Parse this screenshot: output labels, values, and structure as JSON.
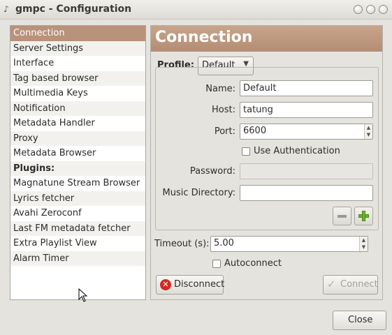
{
  "window": {
    "title": "gmpc - Configuration"
  },
  "sidebar": {
    "items": [
      {
        "label": "Connection"
      },
      {
        "label": "Server Settings"
      },
      {
        "label": "Interface"
      },
      {
        "label": "Tag based browser"
      },
      {
        "label": "Multimedia Keys"
      },
      {
        "label": "Notification"
      },
      {
        "label": "Metadata Handler"
      },
      {
        "label": "Proxy"
      },
      {
        "label": "Metadata Browser"
      },
      {
        "label": "Plugins:"
      },
      {
        "label": "Magnatune Stream Browser"
      },
      {
        "label": "Lyrics fetcher"
      },
      {
        "label": "Avahi Zeroconf"
      },
      {
        "label": "Last FM metadata fetcher"
      },
      {
        "label": "Extra Playlist View"
      },
      {
        "label": "Alarm Timer"
      }
    ],
    "selected": "Connection"
  },
  "panel": {
    "heading": "Connection",
    "profile_label": "Profile:",
    "profile_value": "Default",
    "name_label": "Name:",
    "name_value": "Default",
    "host_label": "Host:",
    "host_value": "tatung",
    "port_label": "Port:",
    "port_value": "6600",
    "use_auth_label": "Use Authentication",
    "use_auth_checked": false,
    "password_label": "Password:",
    "password_value": "",
    "music_dir_label": "Music Directory:",
    "music_dir_value": "",
    "timeout_label": "Timeout (s):",
    "timeout_value": "5.00",
    "autoconnect_label": "Autoconnect",
    "autoconnect_checked": false,
    "disconnect_label": "Disconnect",
    "connect_label": "Connect"
  },
  "footer": {
    "close_label": "Close"
  },
  "colors": {
    "accent": "#b8927a",
    "window_bg": "#e5e3de",
    "add_green": "#6fb12c",
    "disconnect_red": "#d02b24"
  },
  "icons": {
    "app": "gmpc-icon",
    "add": "plus-icon",
    "remove": "minus-icon",
    "disconnect": "stop-icon",
    "connect": "checkmark-icon",
    "dropdown": "triangle-down-icon"
  }
}
